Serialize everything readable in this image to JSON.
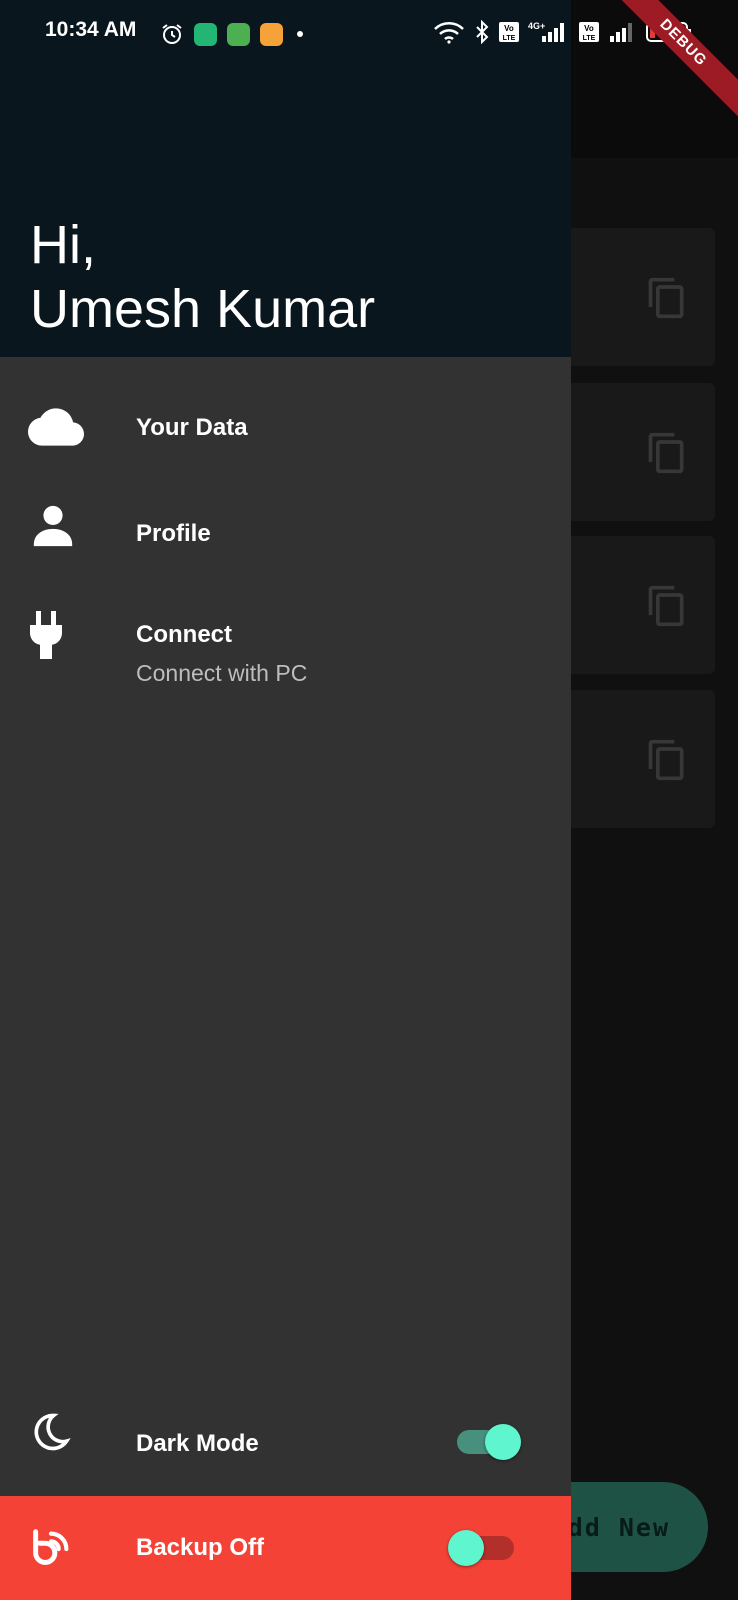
{
  "status_bar": {
    "time": "10:34 AM",
    "battery": "15",
    "left_icons": [
      "alarm-icon",
      "shield-app-icon",
      "cat-app-icon",
      "gallery-app-icon",
      "dot-icon"
    ],
    "right_icons": [
      "wifi-icon",
      "bluetooth-icon",
      "volte-icon",
      "signal-4g-icon",
      "volte-icon",
      "signal-icon",
      "battery-icon"
    ],
    "network_label": "4G+",
    "volte_label": "Vo LTE"
  },
  "debug_banner": "DEBUG",
  "drawer": {
    "greeting_line1": "Hi,",
    "greeting_line2": "Umesh Kumar",
    "items": [
      {
        "icon": "cloud-icon",
        "label": "Your Data"
      },
      {
        "icon": "person-icon",
        "label": "Profile"
      },
      {
        "icon": "plug-icon",
        "label": "Connect",
        "subtitle": "Connect with PC"
      }
    ],
    "dark_mode": {
      "icon": "moon-icon",
      "label": "Dark Mode",
      "enabled": true
    },
    "backup": {
      "icon": "backup-icon",
      "label": "Backup Off",
      "enabled": false
    }
  },
  "background": {
    "fab_label": "Add New",
    "fab_visible_text": "dd New",
    "card_count": 4
  },
  "colors": {
    "drawer_bg": "#323232",
    "header_bg": "#0a161d",
    "accent": "#5ff5cf",
    "backup_bar": "#f44336",
    "fab": "#2f7f6a"
  }
}
